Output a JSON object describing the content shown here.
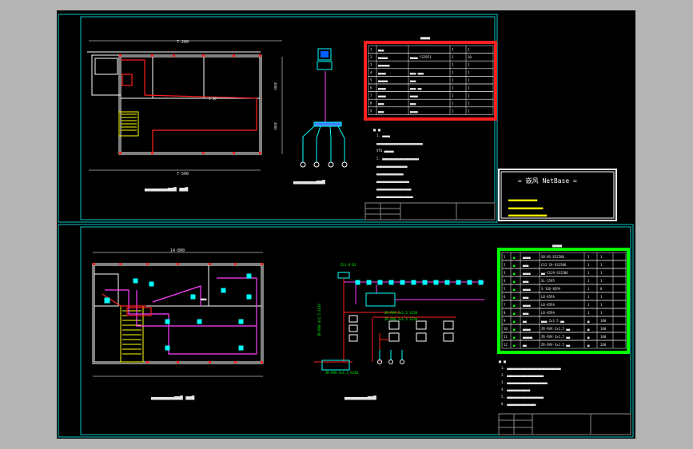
{
  "colors": {
    "background": "#000000",
    "frame": "#00c8c8",
    "wall": "#ffffff",
    "highlight_red": "#ff2020",
    "cable_magenta": "#ff40ff",
    "device_cyan": "#00ffff",
    "table_green": "#00ff00",
    "text": "#e8e8e8"
  },
  "top_sheet": {
    "plan_width_label": "7·200",
    "plan_bottom_label": "7·500",
    "plan_room_label": "1·30",
    "plan_right_dim": "3000",
    "plan_right_dim2": "3000",
    "plan_caption": "▄▄▄▄▄▄▄▄▅▅▆ ▅▅▆",
    "topology_caption": "▄▄▄▄▄▄▄▄▅▅▆",
    "equipment_table": {
      "title": "▄▄▄▄",
      "rows": [
        [
          "1",
          "▄▄▄",
          "",
          "1",
          "1"
        ],
        [
          "2",
          "▄▄▄▄▄",
          "▄▄▄▄ CS2951",
          "1",
          "10"
        ],
        [
          "3",
          "▄▄▄▄▄▄",
          "",
          "1",
          "1"
        ],
        [
          "4",
          "▄▄▄▄",
          "▄▄▄ ▄▄▄",
          "1",
          "1"
        ],
        [
          "5",
          "▄▄▄▄▄",
          "▄▄▄",
          "1",
          "1"
        ],
        [
          "6",
          "▄▄▄▄",
          "▄▄▄ ▄▄",
          "1",
          "1"
        ],
        [
          "7",
          "▄▄▄▄",
          "▄▄▄▄",
          "1",
          "1"
        ],
        [
          "8",
          "▄▄▄",
          "▄▄▄",
          "1",
          "1"
        ],
        [
          "9",
          "▄▄▄",
          "▄▄▄▄",
          "1",
          "1"
        ]
      ]
    },
    "notes_title": "▄ ▄",
    "notes": [
      "1. ▄▄▄▄",
      "   ▄▄▄▄▄▄▄▄▄▄▄▄▄▄▄▄▄▄▄▄▄▄▄▄",
      "VTU ▄▄▄▄▄",
      "2. ▄▄▄▄▄▄▄▄▄▄▄▄▄▄▄▄▄▄▄",
      "   ▄▄▄▄▄▄▄▄▄▄▄▄▄▄▄▄",
      "   ▄▄▄▄▄▄▄▄▄▄▄▄▄▄",
      "   ▄▄▄▄▄▄▄▄▄▄▄▄▄▄▄▄▄",
      "   ▄▄▄▄▄▄▄▄▄▄▄▄▄▄▄▄▄▄",
      "   ▄▄▄▄▄▄▄▄▄▄▄▄▄▄▄▄▄▄▄"
    ],
    "logo": {
      "title": "= 嵌风 NetBase =",
      "line1": "▄▄▄▄▄▄▄▄▄▄▄▄▄▄▄",
      "line2": "▄▄▄▄▄▄▄▄▄▄▄▄▄▄▄▄▄▄",
      "line3": "▄▄▄▄▄▄▄▄▄▄▄▄▄▄▄▄▄▄▄▄"
    }
  },
  "bottom_sheet": {
    "plan_width_label": "14·800",
    "plan_caption": "▄▄▄▄▄▄▄▄▅▅▆ ▅▅▆",
    "wiring_caption": "▄▄▄▄▄▄▄▄▅▅▆",
    "room_label": "▄▄▄",
    "equipment_table": {
      "title": "▄▄▄▄",
      "rows": [
        [
          "1",
          "▄",
          "▄▄▄▄",
          "SB-8S-ES2506",
          "1",
          "1"
        ],
        [
          "2",
          "▄",
          "▄▄▄",
          "CS2-19-SS2506",
          "1",
          "1"
        ],
        [
          "3",
          "▄",
          "▄▄▄▄",
          "▄▄-CS19-SS2506",
          "1",
          "1"
        ],
        [
          "4",
          "▄",
          "▄▄▄",
          "SL-1595",
          "1",
          "1"
        ],
        [
          "5",
          "▄",
          "▄▄▄▄",
          "S-1SD-85PA",
          "1",
          "8"
        ],
        [
          "6",
          "▄",
          "▄▄▄",
          "LB-85PA",
          "1",
          "1"
        ],
        [
          "7",
          "▄",
          "▄▄▄▄",
          "LB-85PA",
          "1",
          "1"
        ],
        [
          "8",
          "▄",
          "▄▄▄",
          "LB-85PA",
          "1",
          "1"
        ],
        [
          "9",
          "▄",
          "▄▄",
          "▄▄▄ 2x1.5 ▄▄",
          "▄",
          "100"
        ],
        [
          "10",
          "▄",
          "▄▄▄▄",
          "ZR-RVV-2x1.5 ▄▄",
          "▄",
          "100"
        ],
        [
          "11",
          "▄",
          "▄▄▄▄▄",
          "ZR-RVV-3x1.5 ▄▄",
          "▄",
          "100"
        ],
        [
          "12",
          "▄",
          "▄▄",
          "ZR-RVV-3x1.5 ▄▄",
          "▄",
          "200"
        ]
      ]
    },
    "notes_title": "▄ ▄",
    "notes": [
      "1. ▄▄▄▄▄▄▄▄▄▄▄▄▄▄▄▄▄▄▄▄▄▄▄▄▄▄▄▄",
      "2. ▄▄▄▄▄▄▄▄▄▄▄▄▄▄▄▄▄▄▄",
      "3. ▄▄▄▄▄▄▄▄▄▄▄▄▄▄▄▄▄▄▄▄▄",
      "4. ▄▄▄▄▄▄▄▄▄▄▄▄",
      "5. ▄▄▄▄▄▄▄▄▄▄▄▄▄▄▄▄▄▄▄",
      "6. ▄▄▄▄▄▄▄▄▄▄▄▄▄▄▄"
    ],
    "wiring_labels": {
      "box1": "ZLJ-U-01",
      "box2": "ZR-RVV-2x1.5 SC20",
      "box3": "ZR-RVV-3x1.5 SC20",
      "box4": "ZR-RVV-2x1.5 SC20",
      "box5": "ZR-RVV-3x1.5 SC20"
    }
  }
}
